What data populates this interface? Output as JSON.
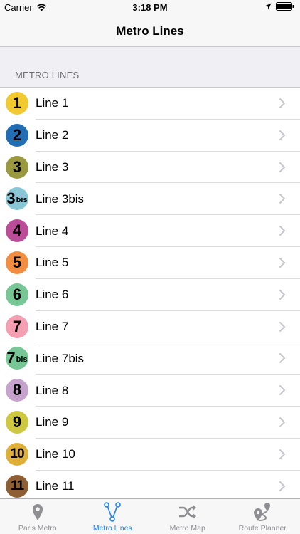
{
  "status_bar": {
    "carrier": "Carrier",
    "time": "3:18 PM"
  },
  "nav": {
    "title": "Metro Lines"
  },
  "section": {
    "header": "METRO LINES"
  },
  "lines": [
    {
      "num": "1",
      "sup": "",
      "label": "Line 1",
      "color": "#f2c931"
    },
    {
      "num": "2",
      "sup": "",
      "label": "Line 2",
      "color": "#216eb4"
    },
    {
      "num": "3",
      "sup": "",
      "label": "Line 3",
      "color": "#9a9940"
    },
    {
      "num": "3",
      "sup": "bis",
      "label": "Line 3bis",
      "color": "#89c7d6"
    },
    {
      "num": "4",
      "sup": "",
      "label": "Line 4",
      "color": "#bb4d98"
    },
    {
      "num": "5",
      "sup": "",
      "label": "Line 5",
      "color": "#f28e42"
    },
    {
      "num": "6",
      "sup": "",
      "label": "Line 6",
      "color": "#77c696"
    },
    {
      "num": "7",
      "sup": "",
      "label": "Line 7",
      "color": "#f59fb3"
    },
    {
      "num": "7",
      "sup": "bis",
      "label": "Line 7bis",
      "color": "#77c696"
    },
    {
      "num": "8",
      "sup": "",
      "label": "Line 8",
      "color": "#c5a3cd"
    },
    {
      "num": "9",
      "sup": "",
      "label": "Line 9",
      "color": "#cdc83f"
    },
    {
      "num": "10",
      "sup": "",
      "label": "Line 10",
      "color": "#dfb039"
    },
    {
      "num": "11",
      "sup": "",
      "label": "Line 11",
      "color": "#8e5e34"
    }
  ],
  "tabs": [
    {
      "label": "Paris Metro",
      "icon": "map-pin-icon",
      "active": false
    },
    {
      "label": "Metro Lines",
      "icon": "metro-lines-icon",
      "active": true
    },
    {
      "label": "Metro Map",
      "icon": "shuffle-icon",
      "active": false
    },
    {
      "label": "Route Planner",
      "icon": "route-icon",
      "active": false
    }
  ]
}
